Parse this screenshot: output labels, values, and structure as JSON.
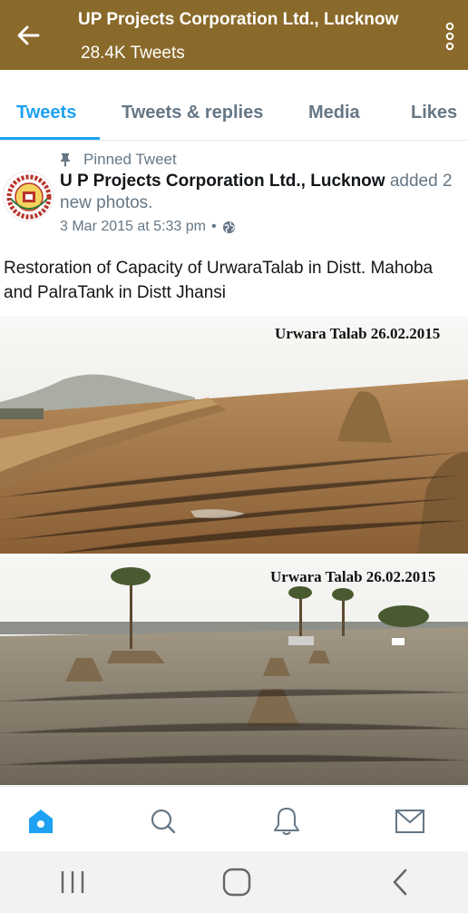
{
  "header": {
    "title": "UP Projects Corporation Ltd., Lucknow",
    "subtitle": "28.4K Tweets",
    "color": "#8a6a2a"
  },
  "tabs": [
    {
      "label": "Tweets",
      "active": true
    },
    {
      "label": "Tweets & replies",
      "active": false
    },
    {
      "label": "Media",
      "active": false
    },
    {
      "label": "Likes",
      "active": false
    }
  ],
  "tweet": {
    "pinned_label": "Pinned Tweet",
    "author": "U P Projects Corporation Ltd., Lucknow",
    "action": " added 2 new photos.",
    "timestamp": "3 Mar 2015 at 5:33 pm",
    "separator": "•",
    "visibility_icon": "globe-icon",
    "text": "Restoration of Capacity of UrwaraTalab in Distt. Mahoba and PalraTank in Distt Jhansi",
    "photos": [
      {
        "caption": "Urwara Talab 26.02.2015"
      },
      {
        "caption": "Urwara Talab 26.02.2015"
      }
    ]
  },
  "bottom_nav": [
    {
      "icon": "home-icon",
      "active": true
    },
    {
      "icon": "search-icon",
      "active": false
    },
    {
      "icon": "notifications-icon",
      "active": false
    },
    {
      "icon": "messages-icon",
      "active": false
    }
  ],
  "accent_color": "#1da1f2"
}
